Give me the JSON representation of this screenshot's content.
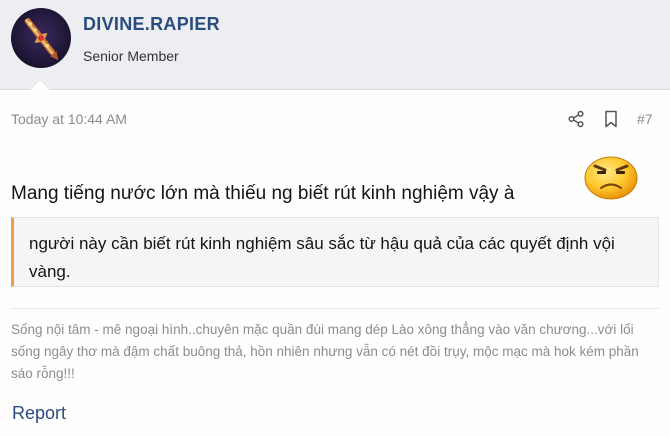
{
  "user": {
    "username": "DIVINE.RAPIER",
    "title": "Senior Member"
  },
  "post": {
    "date": "Today at 10:44 AM",
    "number": "#7",
    "message": "Mang tiếng nước lớn mà thiếu ng biết rút kinh nghiệm vậy à",
    "quote": "người này cần biết rút kinh nghiệm sâu sắc từ hậu quả của các quyết định vội vàng.",
    "signature": "Sống nội tâm - mê ngoại hình..chuyên mặc quần đùi mang dép Lào xông thẳng vào văn chương...với lối sống ngây thơ mà đậm chất buông thả, hồn nhiên nhưng vẫn có nét đồi trụy, mộc mạc mà hok kém phần sáo rỗng!!!"
  },
  "actions": {
    "report_label": "Report",
    "share_icon": "share-icon",
    "bookmark_icon": "bookmark-icon"
  },
  "colors": {
    "username": "#2b4c7e",
    "quote_accent": "#f29d4e",
    "header_bg": "#eceef1"
  }
}
